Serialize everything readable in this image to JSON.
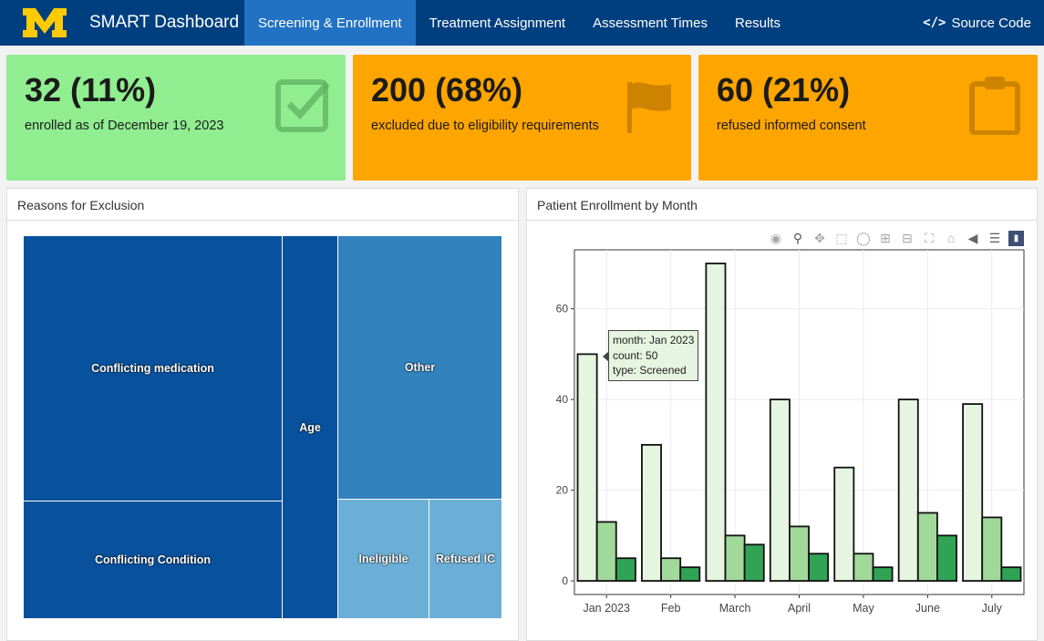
{
  "navbar": {
    "brand": "SMART Dashboard",
    "tabs": [
      {
        "label": "Screening & Enrollment",
        "active": true
      },
      {
        "label": "Treatment Assignment",
        "active": false
      },
      {
        "label": "Assessment Times",
        "active": false
      },
      {
        "label": "Results",
        "active": false
      }
    ],
    "source_code": "Source Code",
    "logo_letter": "M"
  },
  "value_boxes": [
    {
      "value": "32 (11%)",
      "caption": "enrolled as of December 19, 2023",
      "color": "#90ee90",
      "icon": "check-square-icon"
    },
    {
      "value": "200 (68%)",
      "caption": "excluded due to eligibility requirements",
      "color": "#ffa500",
      "icon": "flag-icon"
    },
    {
      "value": "60 (21%)",
      "caption": "refused informed consent",
      "color": "#ffa500",
      "icon": "clipboard-icon"
    }
  ],
  "exclusion_card": {
    "title": "Reasons for Exclusion",
    "tiles": {
      "med": "Conflicting medication",
      "cond": "Conflicting Condition",
      "age": "Age",
      "other": "Other",
      "ineligible": "Ineligible",
      "refused": "Refused IC"
    }
  },
  "enrollment_card": {
    "title": "Patient Enrollment by Month",
    "tooltip": {
      "line1": "month: Jan 2023",
      "line2": "count: 50",
      "line3": "type: Screened"
    }
  },
  "chart_data": {
    "type": "bar",
    "categories": [
      "Jan 2023",
      "Feb",
      "March",
      "April",
      "May",
      "June",
      "July"
    ],
    "series": [
      {
        "name": "Screened",
        "values": [
          50,
          30,
          70,
          40,
          25,
          40,
          39
        ],
        "color": "#e5f5e0"
      },
      {
        "series_slot": 2,
        "values": [
          13,
          5,
          10,
          12,
          6,
          15,
          14
        ],
        "color": "#a1d99b"
      },
      {
        "series_slot": 3,
        "values": [
          5,
          3,
          8,
          6,
          3,
          10,
          3
        ],
        "color": "#31a354"
      }
    ],
    "yticks": [
      0,
      20,
      40,
      60
    ],
    "ylim": [
      -3,
      73
    ],
    "grid": true
  }
}
